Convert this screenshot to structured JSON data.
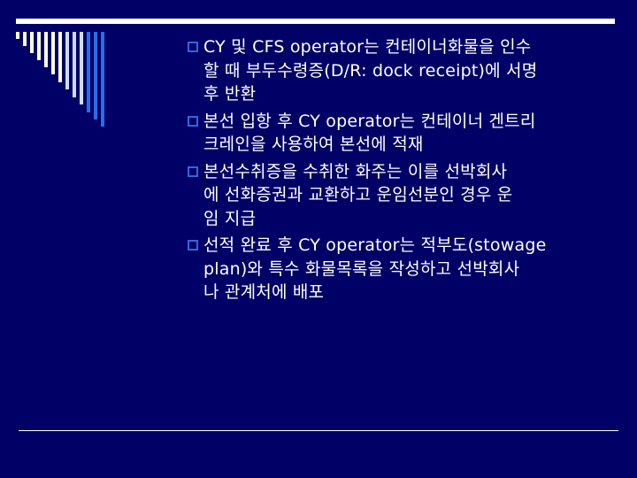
{
  "colors": {
    "background": "#000066",
    "text": "#ffffff",
    "bullet": "#3366dd",
    "stripe_cream": "#ffffe0",
    "stripe_light_blue": "#cfdcff",
    "stripe_blue": "#2a6ee6"
  },
  "bullets": [
    {
      "icon": "hollow-square-bullet-icon",
      "lines": [
        "CY 및 CFS operator는 컨테이너화물을 인수",
        "할 때 부두수령증(D/R: dock receipt)에 서명",
        "후 반환"
      ]
    },
    {
      "icon": "hollow-square-bullet-icon",
      "lines": [
        "본선 입항 후 CY operator는 컨테이너 겐트리",
        "크레인을 사용하여 본선에 적재"
      ]
    },
    {
      "icon": "hollow-square-bullet-icon",
      "lines": [
        "본선수취증을 수취한 화주는 이를 선박회사",
        "에 선화증권과 교환하고 운임선분인 경우 운",
        "임 지급"
      ]
    },
    {
      "icon": "hollow-square-bullet-icon",
      "lines": [
        "선적 완료 후 CY operator는 적부도(stowage",
        "plan)와 특수 화물목록을 작성하고 선박회사",
        "나 관계처에 배포"
      ]
    }
  ]
}
